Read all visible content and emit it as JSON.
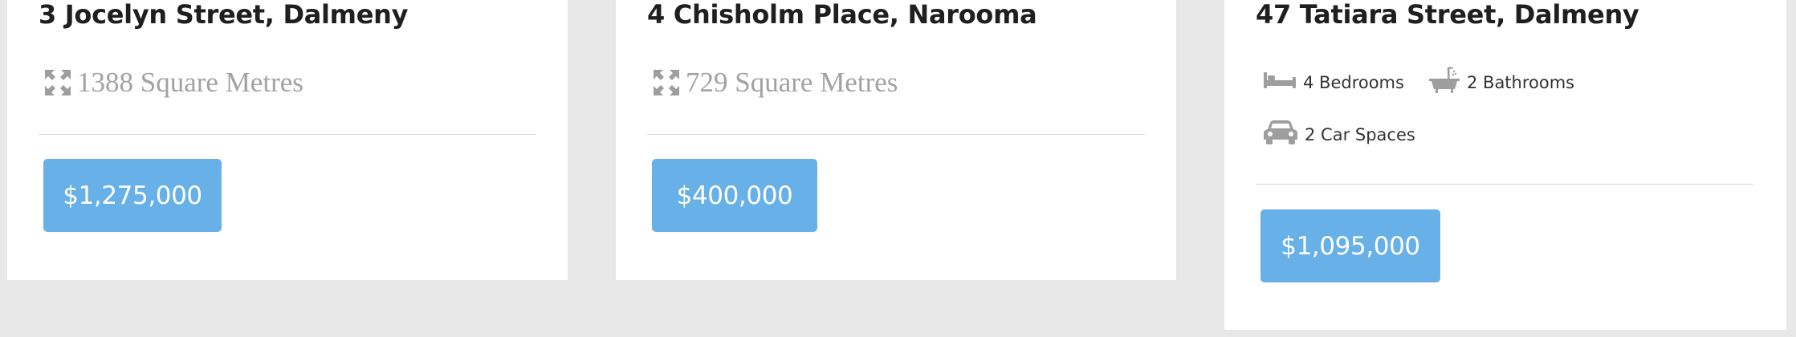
{
  "listings": [
    {
      "address": "3 Jocelyn Street, Dalmeny",
      "area_icon": "expand-arrows-icon",
      "area": "1388 Square Metres",
      "price": "$1,275,000"
    },
    {
      "address": "4 Chisholm Place, Narooma",
      "area_icon": "expand-arrows-icon",
      "area": "729 Square Metres",
      "price": "$400,000"
    },
    {
      "address": "47 Tatiara Street, Dalmeny",
      "features": [
        {
          "icon": "bed-icon",
          "label": "4 Bedrooms"
        },
        {
          "icon": "bathtub-icon",
          "label": "2 Bathrooms"
        },
        {
          "icon": "car-icon",
          "label": "2 Car Spaces"
        }
      ],
      "price": "$1,095,000"
    }
  ],
  "colors": {
    "page_background": "#e8e8e8",
    "card_background": "#ffffff",
    "price_button": "#68b0e8",
    "muted_text": "#a2a2a2",
    "icon_gray": "#9e9e9e"
  }
}
